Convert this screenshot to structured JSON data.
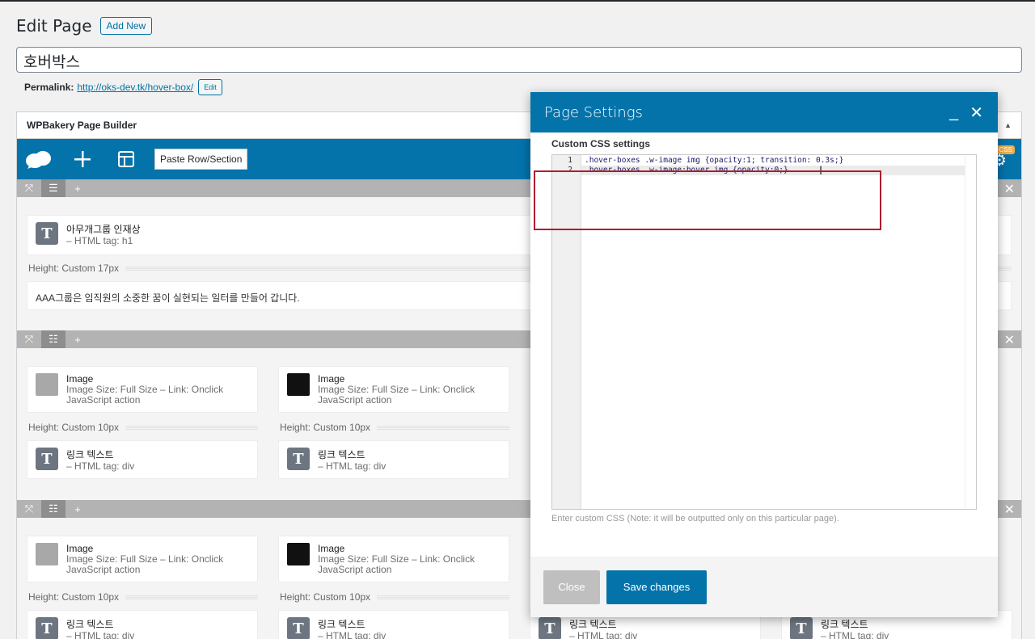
{
  "header": {
    "title": "Edit Page",
    "add_new": "Add New",
    "post_title": "호버박스",
    "permalink_label": "Permalink:",
    "permalink_url": "http://oks-dev.tk/hover-box/",
    "edit_label": "Edit"
  },
  "builder": {
    "title": "WPBakery Page Builder",
    "paste_label": "Paste Row/Section",
    "css_badge": "CSS"
  },
  "row1": {
    "heading_title": "아무개그룹 인재상",
    "heading_sub": "– HTML tag: h1",
    "spacer": "Height: Custom  17px",
    "text": "AAA그룹은 임직원의 소중한 꿈이 실현되는 일터를 만들어 갑니다."
  },
  "row2": {
    "col1": {
      "image_title": "Image",
      "image_sub1": "Image Size: Full Size  – Link: Onclick",
      "image_sub2": "JavaScript action",
      "spacer": "Height: Custom  10px",
      "text_title": "링크 텍스트",
      "text_sub": "– HTML tag: div"
    },
    "col2": {
      "image_title": "Image",
      "image_sub1": "Image Size: Full Size  – Link: Onclick",
      "image_sub2": "JavaScript action",
      "spacer": "Height: Custom  10px",
      "text_title": "링크 텍스트",
      "text_sub": "– HTML tag: div"
    }
  },
  "row3": {
    "col1": {
      "image_title": "Image",
      "image_sub1": "Image Size: Full Size  – Link: Onclick",
      "image_sub2": "JavaScript action",
      "spacer": "Height: Custom  10px",
      "text_title": "링크 텍스트",
      "text_sub": "– HTML tag: div"
    },
    "col2": {
      "image_title": "Image",
      "image_sub1": "Image Size: Full Size  – Link: Onclick",
      "image_sub2": "JavaScript action",
      "spacer": "Height: Custom  10px",
      "text_title": "링크 텍스트",
      "text_sub": "– HTML tag: div"
    },
    "col3": {
      "text_title": "링크 텍스트",
      "text_sub": "– HTML tag: div"
    },
    "col4": {
      "text_title": "링크 텍스트",
      "text_sub": "– HTML tag: div"
    }
  },
  "modal": {
    "title": "Page Settings",
    "field_label": "Custom CSS settings",
    "line_numbers": [
      "1",
      "2"
    ],
    "code_lines": [
      ".hover-boxes .w-image img {opacity:1; transition: 0.3s;}",
      ".hover-boxes .w-image:hover img {opacity:0;}"
    ],
    "hint": "Enter custom CSS (Note: it will be outputted only on this particular page).",
    "close_label": "Close",
    "save_label": "Save changes"
  },
  "colors": {
    "accent": "#0473aa",
    "highlight": "#b01c2e"
  }
}
